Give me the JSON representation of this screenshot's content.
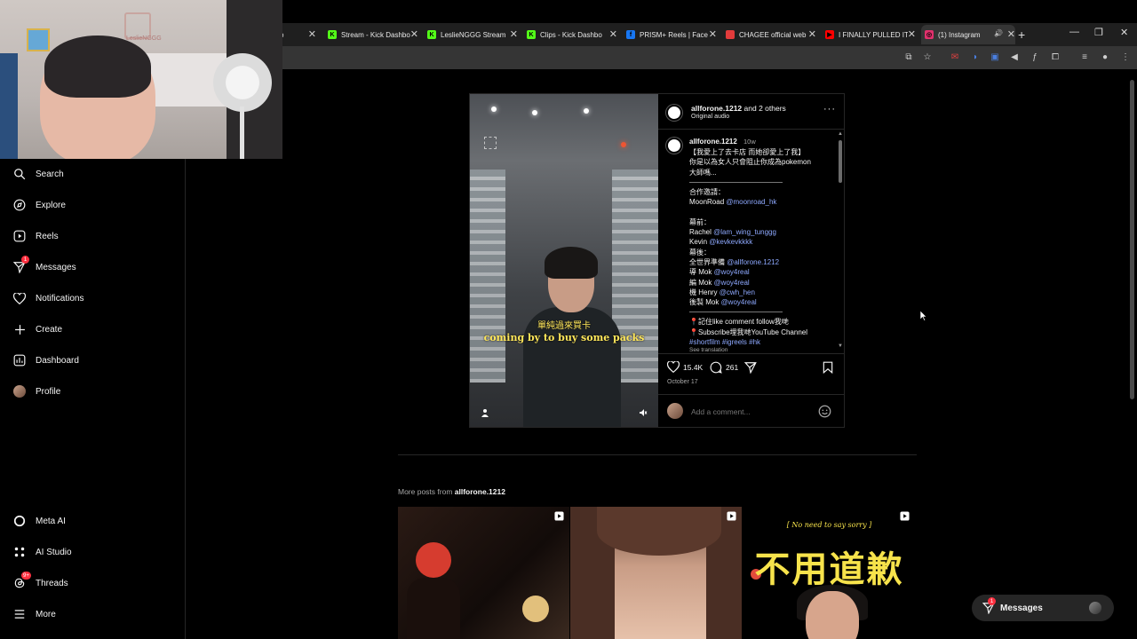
{
  "browser": {
    "tabs": [
      {
        "title": "...ashbo",
        "color": "#2c2c2c",
        "glyph": ""
      },
      {
        "title": "Stream - Kick Dashbo",
        "color": "#53fc18",
        "glyph": "K"
      },
      {
        "title": "LeslieNGGG Stream",
        "color": "#53fc18",
        "glyph": "K"
      },
      {
        "title": "Clips - Kick Dashbo",
        "color": "#53fc18",
        "glyph": "K"
      },
      {
        "title": "PRISM+ Reels | Face",
        "color": "#1877f2",
        "glyph": "f"
      },
      {
        "title": "CHAGEE official web",
        "color": "#e23b3b",
        "glyph": ""
      },
      {
        "title": "I FINALLY PULLED IT",
        "color": "#ff0000",
        "glyph": "▶"
      },
      {
        "title": "(1) Instagram",
        "color": "#e1306c",
        "glyph": "◎"
      }
    ],
    "active_tab_index": 7
  },
  "webcam": {
    "watermark": "LeslieNGGG"
  },
  "sidebar": {
    "items": [
      {
        "label": "Search",
        "icon": "search-icon"
      },
      {
        "label": "Explore",
        "icon": "explore-icon"
      },
      {
        "label": "Reels",
        "icon": "reels-icon"
      },
      {
        "label": "Messages",
        "icon": "messages-icon",
        "badge": "1"
      },
      {
        "label": "Notifications",
        "icon": "heart-icon"
      },
      {
        "label": "Create",
        "icon": "plus-icon"
      },
      {
        "label": "Dashboard",
        "icon": "dashboard-icon"
      },
      {
        "label": "Profile",
        "icon": "avatar"
      }
    ],
    "bottom_items": [
      {
        "label": "Meta AI",
        "icon": "meta-ai-icon"
      },
      {
        "label": "AI Studio",
        "icon": "ai-studio-icon"
      },
      {
        "label": "Threads",
        "icon": "threads-icon",
        "badge": "9+"
      },
      {
        "label": "More",
        "icon": "menu-icon"
      }
    ]
  },
  "post": {
    "subtitle_zh": "單純過來買卡",
    "subtitle_en": "coming by to buy some packs",
    "header_user": "allforone.1212",
    "header_others": "and 2 others",
    "header_audio": "Original audio",
    "caption_user": "allforone.1212",
    "caption_time": "10w",
    "caption_lines": [
      {
        "t": "【我愛上了去卡店 而她卻愛上了我】"
      },
      {
        "t": "你是以為女人只會阻止你成為pokemon"
      },
      {
        "t": "大師嗎..."
      },
      {
        "sep": true
      },
      {
        "t": "合作邀請："
      },
      {
        "t": "MoonRoad ",
        "link": "@moonroad_hk"
      },
      {
        "t": ""
      },
      {
        "t": "幕前："
      },
      {
        "t": "Rachel ",
        "link": "@lam_wing_tunggg"
      },
      {
        "t": "Kevin ",
        "link": "@kevkevkkkk"
      },
      {
        "t": "幕後："
      },
      {
        "t": "全世界準備 ",
        "link": "@allforone.1212"
      },
      {
        "t": "導 Mok ",
        "link": "@woy4real"
      },
      {
        "t": "編 Mok ",
        "link": "@woy4real"
      },
      {
        "t": "機 Henry ",
        "link": "@cwh_hen"
      },
      {
        "t": "後製 Mok ",
        "link": "@woy4real"
      },
      {
        "sep": true
      },
      {
        "t": "📍記住like comment follow我哋"
      },
      {
        "t": "📍Subscribe埋我哋YouTube Channel"
      },
      {
        "t": "",
        "link": "#shortfilm #igreels #hk"
      }
    ],
    "see_translation": "See translation",
    "likes": "15.4K",
    "comments": "261",
    "date": "October 17",
    "comment_placeholder": "Add a comment..."
  },
  "more_posts": {
    "prefix": "More posts from",
    "user": "allforone.1212",
    "thumb3_tagline": "No need to say sorry",
    "thumb3_title": "不用道歉"
  },
  "messages_pill": {
    "label": "Messages",
    "badge": "1"
  },
  "colors": {
    "link": "#8ea9ff",
    "badge": "#ff3040",
    "muted": "#a8a8a8"
  }
}
